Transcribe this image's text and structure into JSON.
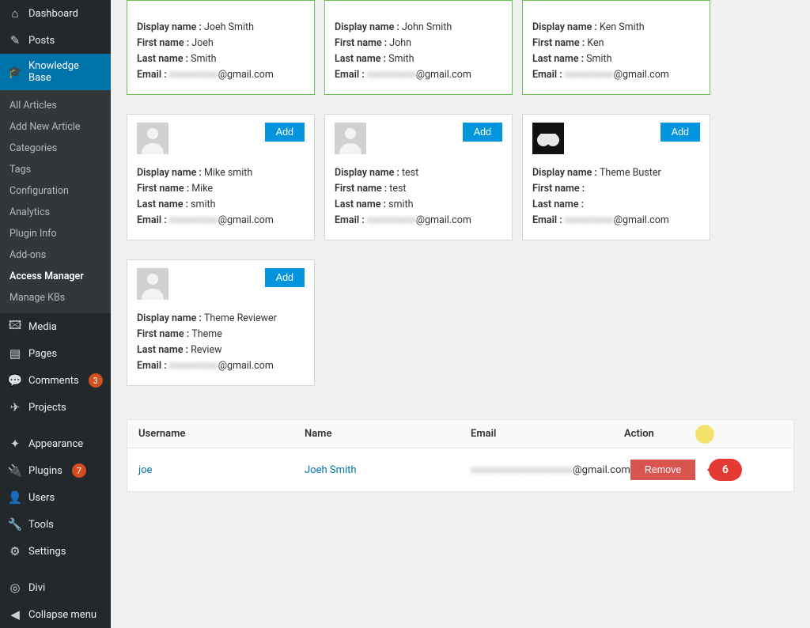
{
  "sidebar": {
    "items": [
      {
        "label": "Dashboard",
        "icon": "⌂"
      },
      {
        "label": "Posts",
        "icon": "✎"
      },
      {
        "label": "Knowledge Base",
        "icon": "🎓",
        "active": true
      },
      {
        "label": "Media",
        "icon": "🖾"
      },
      {
        "label": "Pages",
        "icon": "▤"
      },
      {
        "label": "Comments",
        "icon": "💬",
        "badge": "3"
      },
      {
        "label": "Projects",
        "icon": "✈"
      },
      {
        "label": "Appearance",
        "icon": "✦"
      },
      {
        "label": "Plugins",
        "icon": "🔌",
        "badge": "7"
      },
      {
        "label": "Users",
        "icon": "👤"
      },
      {
        "label": "Tools",
        "icon": "🔧"
      },
      {
        "label": "Settings",
        "icon": "⚙"
      },
      {
        "label": "Divi",
        "icon": "◎"
      },
      {
        "label": "Collapse menu",
        "icon": "◀"
      }
    ],
    "submenu": [
      {
        "label": "All Articles"
      },
      {
        "label": "Add New Article"
      },
      {
        "label": "Categories"
      },
      {
        "label": "Tags"
      },
      {
        "label": "Configuration"
      },
      {
        "label": "Analytics"
      },
      {
        "label": "Plugin Info"
      },
      {
        "label": "Add-ons"
      },
      {
        "label": "Access Manager",
        "current": true
      },
      {
        "label": "Manage KBs"
      }
    ]
  },
  "labels": {
    "display_name": "Display name :",
    "first_name": "First name :",
    "last_name": "Last name :",
    "email": "Email :",
    "add": "Add"
  },
  "cards_row1": [
    {
      "display": "Joeh Smith",
      "first": "Joeh",
      "last": "Smith",
      "email_vis": "@gmail.com",
      "selected": true,
      "noavatar": true,
      "noadd": true
    },
    {
      "display": "John Smith",
      "first": "John",
      "last": "Smith",
      "email_vis": "@gmail.com",
      "selected": true,
      "noavatar": true,
      "noadd": true
    },
    {
      "display": "Ken Smith",
      "first": "Ken",
      "last": "Smith",
      "email_vis": "@gmail.com",
      "selected": true,
      "noavatar": true,
      "noadd": true
    }
  ],
  "cards_row2": [
    {
      "display": "Mike smith",
      "first": "Mike",
      "last": "smith",
      "email_vis": "@gmail.com"
    },
    {
      "display": "test",
      "first": "test",
      "last": "smith",
      "email_vis": "@gmail.com"
    },
    {
      "display": "Theme Buster",
      "first": "",
      "last": "",
      "email_vis": "@gmail.com",
      "dark": true
    }
  ],
  "cards_row3": [
    {
      "display": "Theme Reviewer",
      "first": "Theme",
      "last": "Review",
      "email_vis": "@gmail.com"
    }
  ],
  "table": {
    "headers": {
      "username": "Username",
      "name": "Name",
      "email": "Email",
      "action": "Action"
    },
    "rows": [
      {
        "username": "joe",
        "name": "Joeh Smith",
        "email_vis": "@gmail.com",
        "remove": "Remove"
      }
    ]
  },
  "marker_step": "6"
}
